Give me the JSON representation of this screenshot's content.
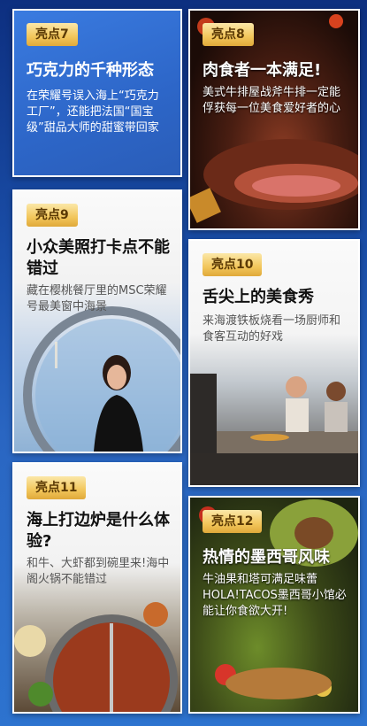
{
  "cards": [
    {
      "badge": "亮点7",
      "title": "巧克力的千种形态",
      "desc": "在荣耀号误入海上“巧克力工厂”，还能把法国“国宝级”甜品大师的甜蜜带回家"
    },
    {
      "badge": "亮点8",
      "title": "肉食者一本满足!",
      "desc": "美式牛排屋战斧牛排一定能俘获每一位美食爱好者的心"
    },
    {
      "badge": "亮点9",
      "title": "小众美照打卡点不能错过",
      "desc": "藏在樱桃餐厅里的MSC荣耀号最美窗中海景"
    },
    {
      "badge": "亮点10",
      "title": "舌尖上的美食秀",
      "desc": "来海渡铁板烧看一场厨师和食客互动的好戏"
    },
    {
      "badge": "亮点11",
      "title": "海上打边炉是什么体验?",
      "desc": "和牛、大虾都到碗里来!海中阁火锅不能错过"
    },
    {
      "badge": "亮点12",
      "title": "热情的墨西哥风味",
      "desc": "牛油果和塔可满足味蕾HOLA!TACOS墨西哥小馆必能让你食欲大开!"
    }
  ],
  "colors": {
    "background": "#1a4ea8",
    "badge": "#f2c65b",
    "card7": "#3a7be0"
  }
}
